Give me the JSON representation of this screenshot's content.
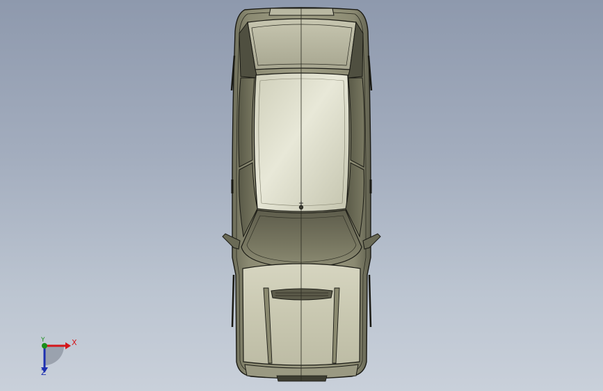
{
  "viewport": {
    "background_top": "#8e99ad",
    "background_bottom": "#c9d0da",
    "model_name": "car-top-view"
  },
  "triad": {
    "x_label": "X",
    "y_label": "Y",
    "z_label": "Z",
    "x_color": "#d4161b",
    "y_color": "#1a8f1a",
    "z_color": "#1d2fb0"
  }
}
